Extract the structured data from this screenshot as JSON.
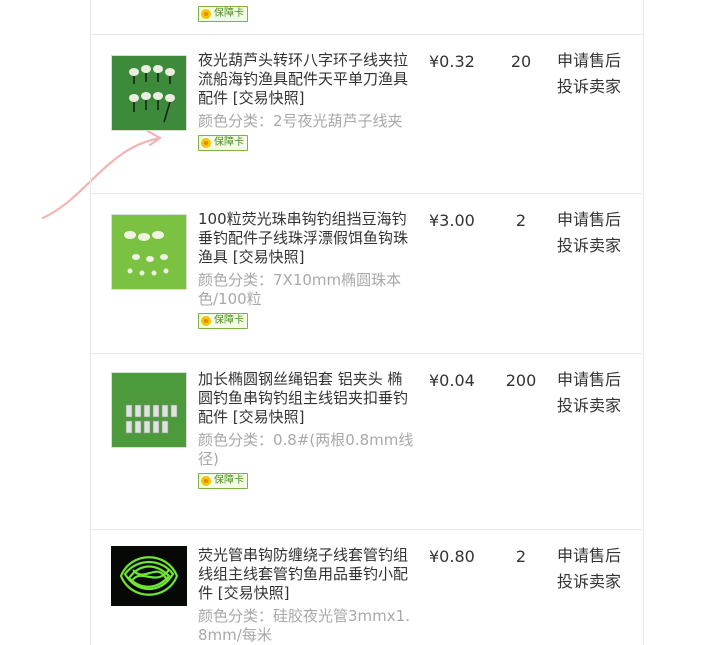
{
  "guarantee_label": "保障卡",
  "currency": "¥",
  "items": [
    {
      "title": "夜光葫芦头转环八字环子线夹拉流船海钓渔具配件天平单刀渔具配件",
      "snapshot": "[交易快照]",
      "sku": "颜色分类：2号夜光葫芦子线夹",
      "price": "¥0.32",
      "qty": "20",
      "refund": "申请售后",
      "complain": "投诉卖家"
    },
    {
      "title": "100粒荧光珠串钩钓组挡豆海钓垂钓配件子线珠浮漂假饵鱼钩珠渔具",
      "snapshot": "[交易快照]",
      "sku": "颜色分类：7X10mm椭圆珠本色/100粒",
      "price": "¥3.00",
      "qty": "2",
      "refund": "申请售后",
      "complain": "投诉卖家"
    },
    {
      "title": "加长椭圆钢丝绳铝套 铝夹头 椭圆钓鱼串钩钓组主线铝夹扣垂钓配件",
      "snapshot": "[交易快照]",
      "sku": "颜色分类：0.8#(两根0.8mm线径)",
      "price": "¥0.04",
      "qty": "200",
      "refund": "申请售后",
      "complain": "投诉卖家"
    },
    {
      "title": "荧光管串钩防缠绕子线套管钓组线组主线套管钓鱼用品垂钓小配件",
      "snapshot": "[交易快照]",
      "sku": "颜色分类：硅胶夜光管3mmx1.8mm/每米",
      "price": "¥0.80",
      "qty": "2",
      "refund": "申请售后",
      "complain": "投诉卖家"
    }
  ]
}
